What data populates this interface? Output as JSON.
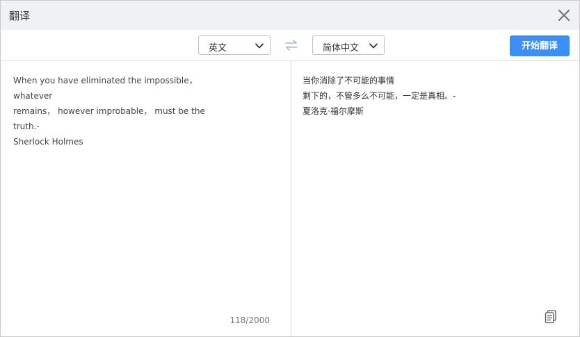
{
  "dialog": {
    "title": "翻译",
    "close_icon": "close-icon"
  },
  "toolbar": {
    "source_language": "英文",
    "target_language": "简体中文",
    "swap_icon": "swap-arrows-icon",
    "translate_button": "开始翻译"
  },
  "source": {
    "text": "When you have eliminated the impossible， whatever\nremains， however improbable， must be the truth.-\nSherlock Holmes",
    "char_count": "118/2000"
  },
  "result": {
    "text": "当你消除了不可能的事情\n剩下的，不管多么不可能，一定是真相。-\n夏洛克·福尔摩斯",
    "copy_icon": "copy-icon"
  },
  "colors": {
    "accent": "#3a8ef6",
    "titlebar": "#f0f1f4"
  }
}
